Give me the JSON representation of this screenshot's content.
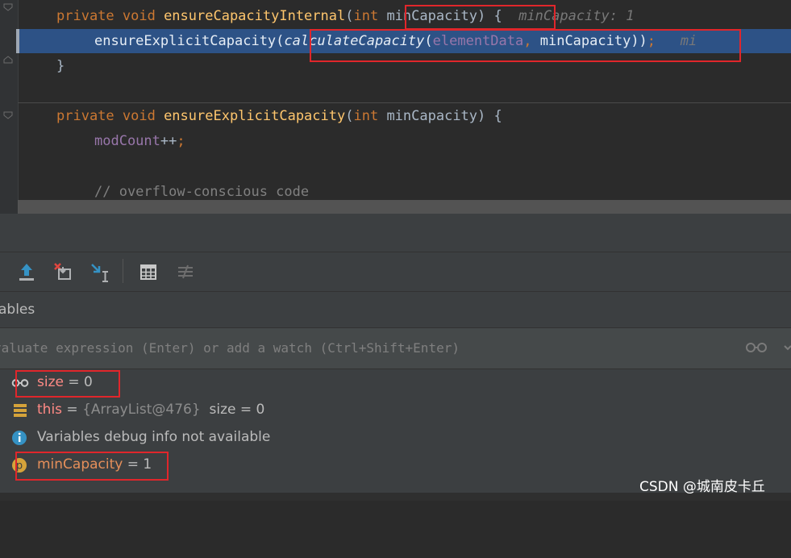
{
  "editor": {
    "lines": [
      {
        "parts": [
          [
            "kw",
            "private void "
          ],
          [
            "fn",
            "ensureCapacityInternal"
          ],
          [
            "",
            "("
          ],
          [
            "kw",
            "int "
          ],
          [
            "",
            "minCapacity) {  "
          ],
          [
            "hint",
            "minCapacity: 1"
          ]
        ]
      },
      {
        "parts": [
          [
            "",
            "ensureExplicitCapacity("
          ],
          [
            "it",
            "calculateCapacity"
          ],
          [
            "",
            "("
          ],
          [
            "fld",
            "elementData"
          ],
          [
            "kw",
            ", "
          ],
          [
            "",
            "minCapacity))"
          ],
          [
            "kw",
            ";"
          ],
          [
            "hint",
            "   mi"
          ]
        ]
      },
      {
        "parts": [
          [
            "",
            "}"
          ]
        ]
      },
      {
        "parts": [
          [
            "kw",
            "private void "
          ],
          [
            "fn",
            "ensureExplicitCapacity"
          ],
          [
            "",
            "("
          ],
          [
            "kw",
            "int "
          ],
          [
            "",
            "minCapacity) {"
          ]
        ]
      },
      {
        "parts": [
          [
            "fld",
            "modCount"
          ],
          [
            "",
            "++"
          ],
          [
            "kw",
            ";"
          ]
        ]
      },
      {
        "parts": [
          [
            "cmt",
            "// overflow-conscious code"
          ]
        ]
      }
    ]
  },
  "debugger": {
    "toolbar": [
      "step-out-icon",
      "drop-frame-icon",
      "run-to-cursor-icon",
      "evaluate-table-icon",
      "trace-over-icon"
    ],
    "variables_title": "ables",
    "watch_placeholder": "valuate expression (Enter) or add a watch (Ctrl+Shift+Enter)",
    "variables": [
      {
        "icon": "watch-glasses-icon",
        "name": "size",
        "rest": " = 0"
      },
      {
        "icon": "stack-icon",
        "name": "this",
        "eq": " = ",
        "type": "{ArrayList@476}",
        "extra": "  size = 0"
      },
      {
        "icon": "info-icon",
        "msg": "Variables debug info not available"
      },
      {
        "icon": "parameter-icon",
        "name": "minCapacity",
        "rest": " = 1"
      }
    ]
  },
  "watermark": "CSDN @城南皮卡丘",
  "colors": {
    "highlight": "#2d5286",
    "annotation": "#e0262b",
    "keyword": "#cc7832",
    "method": "#ffc66d",
    "field": "#9876aa"
  }
}
